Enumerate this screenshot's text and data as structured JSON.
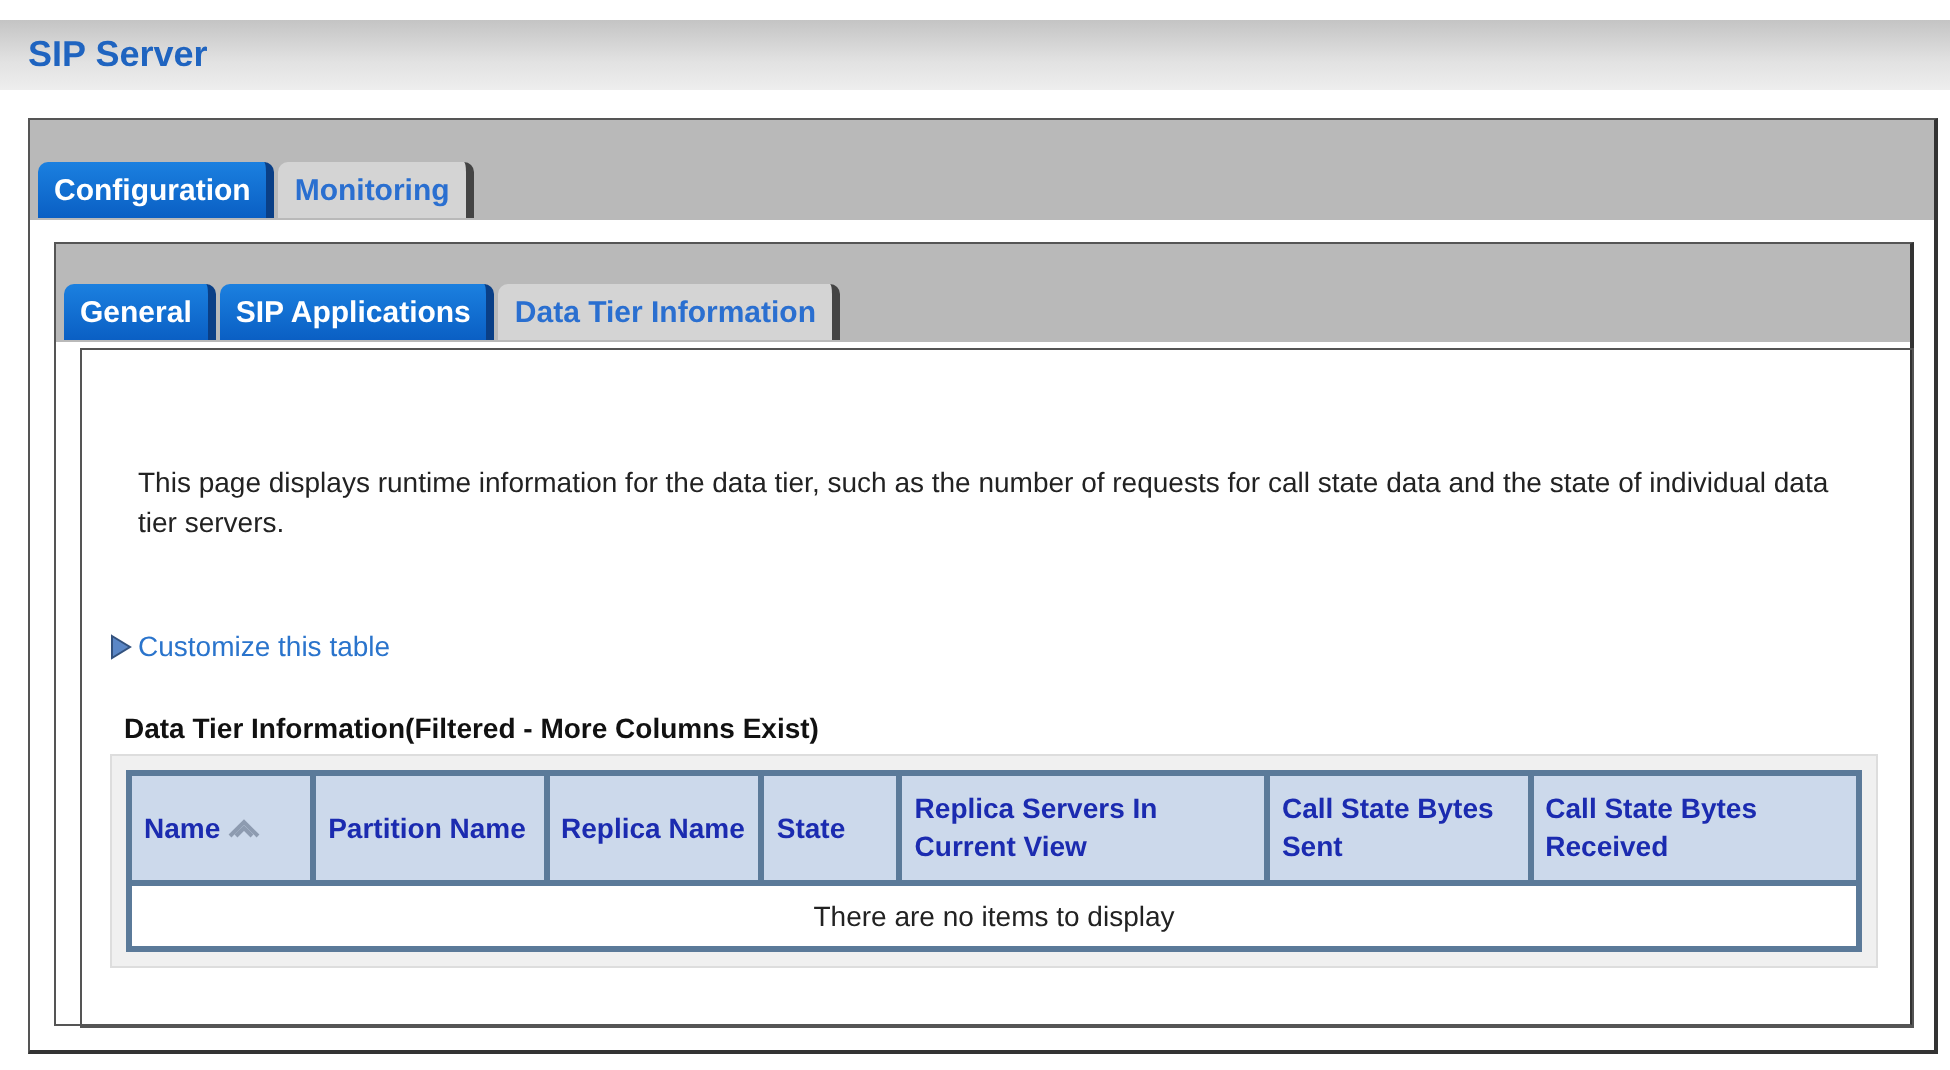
{
  "header": {
    "title": "SIP Server"
  },
  "main_tabs": [
    {
      "label": "Configuration",
      "selected": false
    },
    {
      "label": "Monitoring",
      "selected": true
    }
  ],
  "sub_tabs": [
    {
      "label": "General",
      "selected": false
    },
    {
      "label": "SIP Applications",
      "selected": false
    },
    {
      "label": "Data Tier Information",
      "selected": true
    }
  ],
  "description": "This page displays runtime information for the data tier, such as the number of requests for call state data and the state of individual data tier servers.",
  "customize_link": "Customize this table",
  "table": {
    "title": "Data Tier Information(Filtered - More Columns Exist)",
    "columns": [
      {
        "label": "Name",
        "sorted": true
      },
      {
        "label": "Partition Name",
        "sorted": false
      },
      {
        "label": "Replica Name",
        "sorted": false
      },
      {
        "label": "State",
        "sorted": false
      },
      {
        "label": "Replica Servers In Current View",
        "sorted": false
      },
      {
        "label": "Call State Bytes Sent",
        "sorted": false
      },
      {
        "label": "Call State Bytes Received",
        "sorted": false
      }
    ],
    "empty_message": "There are no items to display"
  }
}
